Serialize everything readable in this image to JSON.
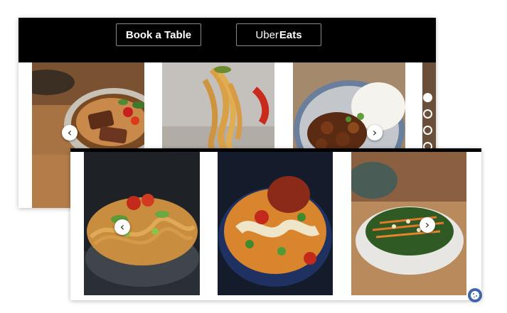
{
  "header": {
    "book_table_label": "Book a Table",
    "uber_label_part1": "Uber",
    "uber_label_part2": "Eats"
  },
  "icons": {
    "prev": "chevron-left-icon",
    "next": "chevron-right-icon",
    "cookie": "cookie-icon"
  },
  "colors": {
    "header_bg": "#000000",
    "cookie_badge": "#3f66ad"
  },
  "carousel_top": {
    "dots_total": 4,
    "active_dot": 1,
    "slides": [
      "duck-curry-photo",
      "noodles-on-fork-photo",
      "chicken-rice-bowl-photo"
    ]
  },
  "carousel_bottom": {
    "slides": [
      "noodle-salad-photo",
      "coconut-curry-soup-photo",
      "sesame-greens-salad-photo"
    ]
  }
}
